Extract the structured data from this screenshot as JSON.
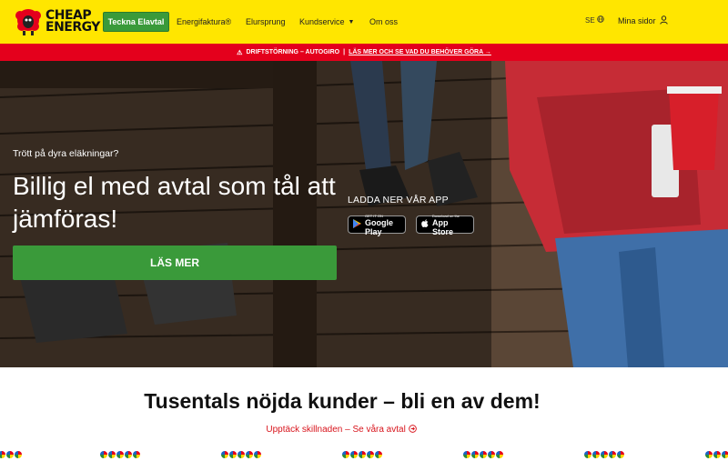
{
  "header": {
    "logo_line1": "CHEAP",
    "logo_line2": "ENERGY",
    "cta_label": "Teckna Elavtal",
    "nav": [
      {
        "label": "Energifaktura®"
      },
      {
        "label": "Elursprung"
      },
      {
        "label": "Kundservice"
      },
      {
        "label": "Om oss"
      }
    ],
    "lang": "SE",
    "account_label": "Mina sidor"
  },
  "alert": {
    "icon": "warning-icon",
    "text": "DRIFTSTÖRNING – AUTOGIRO",
    "separator": "|",
    "link_text": "LÄS MER OCH SE VAD DU BEHÖVER GÖRA →"
  },
  "hero": {
    "subtitle": "Trött på dyra eläkningar?",
    "title": "Billig el med avtal som tål att jämföras!",
    "button_label": "LÄS MER",
    "app_heading": "LADDA NER VÅR APP",
    "google_small": "GET IT ON",
    "google_big": "Google Play",
    "apple_small": "Download on the",
    "apple_big": "App Store"
  },
  "content": {
    "title": "Tusentals nöjda kunder – bli en av dem!",
    "link": "Upptäck skillnaden – Se våra avtal"
  },
  "colors": {
    "brand_yellow": "#ffe600",
    "alert_red": "#e4001c",
    "cta_green": "#3a9a3a",
    "link_red": "#d8141c"
  }
}
